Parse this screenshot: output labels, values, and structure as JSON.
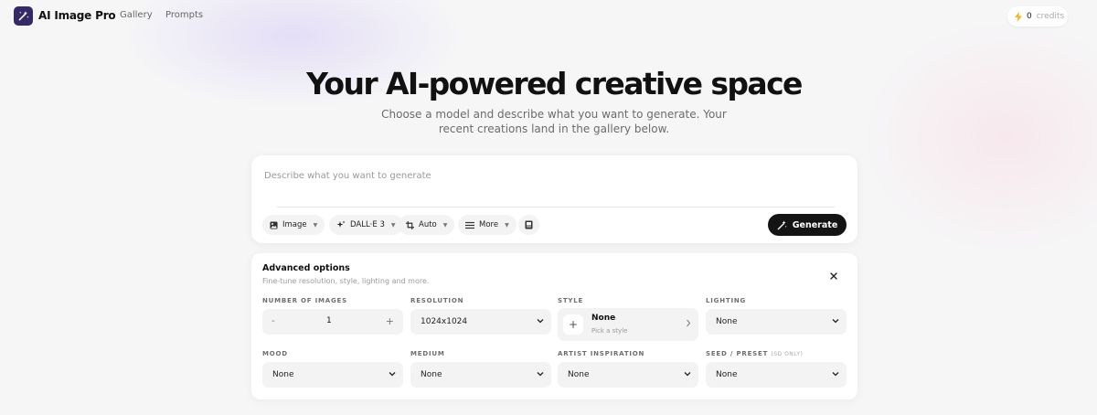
{
  "app": {
    "name": "AI Image Pro",
    "nav": [
      {
        "label": "Gallery"
      },
      {
        "label": "Prompts"
      }
    ],
    "credits": {
      "count": "0",
      "label": "credits"
    }
  },
  "hero": {
    "title": "Your AI-powered creative space",
    "subtitle": "Choose a model and describe what you want to generate. Your recent creations land in the gallery below."
  },
  "prompt": {
    "placeholder": "Describe what you want to generate",
    "value": "",
    "chips": [
      {
        "icon": "image-icon",
        "label": "Image"
      },
      {
        "icon": "sparkle-icon",
        "label": "DALL·E 3"
      },
      {
        "icon": "crop-icon",
        "label": "Auto"
      },
      {
        "icon": "sliders-icon",
        "label": "More"
      }
    ],
    "generate_label": "Generate"
  },
  "advanced": {
    "title": "Advanced options",
    "subtitle": "Fine-tune resolution, style, lighting and more.",
    "fields": {
      "number_of_images": {
        "label": "NUMBER OF IMAGES",
        "value": "1",
        "minus": "-",
        "plus": "+"
      },
      "resolution": {
        "label": "RESOLUTION",
        "value": "1024x1024"
      },
      "style": {
        "label": "STYLE",
        "value": "None",
        "hint": "Pick a style"
      },
      "lighting": {
        "label": "LIGHTING",
        "value": "None"
      },
      "mood": {
        "label": "MOOD",
        "value": "None"
      },
      "medium": {
        "label": "MEDIUM",
        "value": "None"
      },
      "artist": {
        "label": "ARTIST INSPIRATION",
        "value": "None"
      },
      "seed": {
        "label": "SEED / PRESET",
        "sublabel": "(SD ONLY)",
        "value": "None"
      }
    }
  },
  "colors": {
    "brand": "#352a66",
    "background": "#f6f6f7",
    "primary_button": "#141414",
    "field_bg": "#f3f3f4",
    "credits_icon": "#f0b429"
  }
}
